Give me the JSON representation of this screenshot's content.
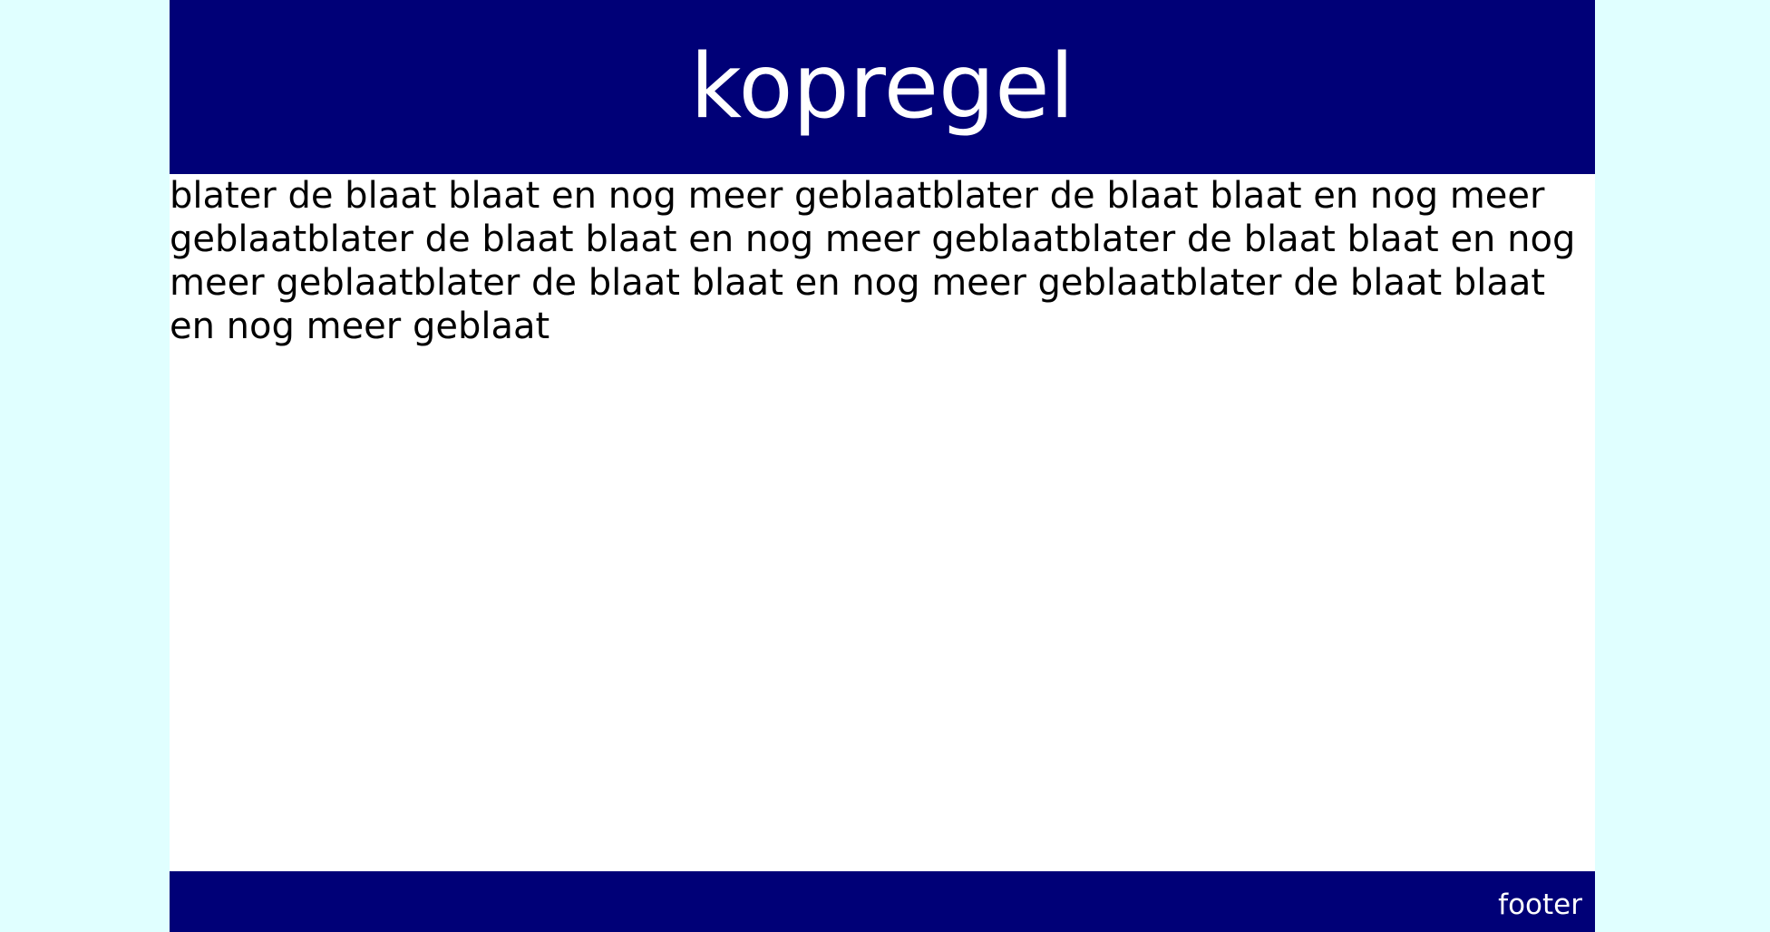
{
  "header": {
    "title": "kopregel"
  },
  "content": {
    "text": "blater de blaat blaat en nog meer geblaatblater de blaat blaat en nog meer geblaatblater de blaat blaat en nog meer geblaatblater de blaat blaat en nog meer geblaatblater de blaat blaat en nog meer geblaatblater de blaat blaat en nog meer geblaat"
  },
  "footer": {
    "text": "footer"
  },
  "colors": {
    "page_background": "#e0ffff",
    "header_background": "#000077",
    "footer_background": "#000077",
    "content_background": "#ffffff",
    "header_text": "#ffffff",
    "footer_text": "#ffffff",
    "content_text": "#000000"
  }
}
